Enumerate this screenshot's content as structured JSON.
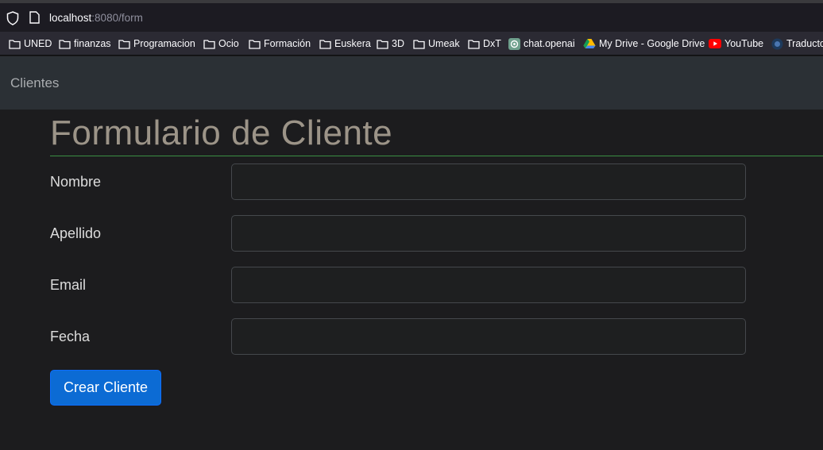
{
  "browser": {
    "url_host": "localhost",
    "url_path": ":8080/form"
  },
  "bookmarks": [
    {
      "label": "UNED",
      "icon": "folder-icon"
    },
    {
      "label": "finanzas",
      "icon": "folder-icon"
    },
    {
      "label": "Programacion",
      "icon": "folder-icon"
    },
    {
      "label": "Ocio",
      "icon": "folder-icon"
    },
    {
      "label": "Formación",
      "icon": "folder-icon"
    },
    {
      "label": "Euskera",
      "icon": "folder-icon"
    },
    {
      "label": "3D",
      "icon": "folder-icon"
    },
    {
      "label": "Umeak",
      "icon": "folder-icon"
    },
    {
      "label": "DxT",
      "icon": "folder-icon"
    },
    {
      "label": "chat.openai",
      "icon": "openai-icon"
    },
    {
      "label": "My Drive - Google Drive",
      "icon": "google-drive-icon"
    },
    {
      "label": "YouTube",
      "icon": "youtube-icon"
    },
    {
      "label": "Traductor",
      "icon": "translator-icon"
    }
  ],
  "navbar": {
    "brand": "Clientes"
  },
  "form": {
    "title": "Formulario de Cliente",
    "fields": [
      {
        "label": "Nombre",
        "value": ""
      },
      {
        "label": "Apellido",
        "value": ""
      },
      {
        "label": "Email",
        "value": ""
      },
      {
        "label": "Fecha",
        "value": ""
      }
    ],
    "submit_label": "Crear Cliente"
  },
  "colors": {
    "accent_button": "#0c6bd4",
    "title_rule": "#3b8f43",
    "navbar_bg": "#2b3035"
  }
}
